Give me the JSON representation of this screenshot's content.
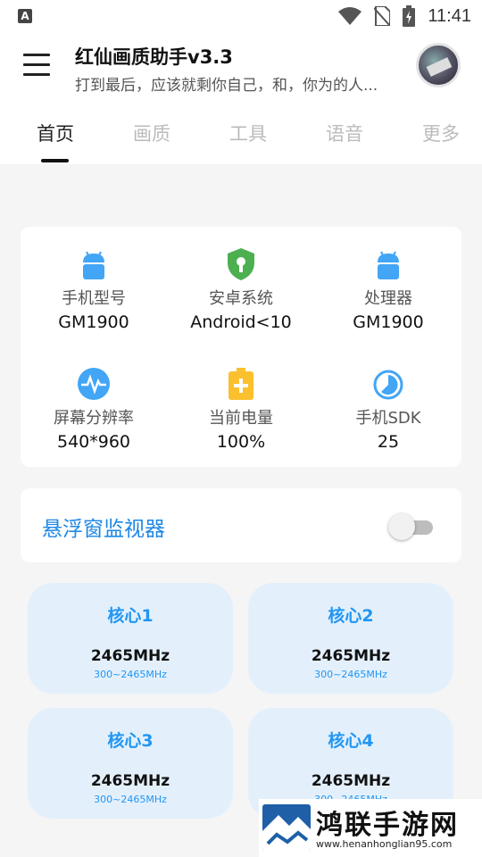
{
  "status_bar": {
    "app_indicator": "A",
    "time": "11:41"
  },
  "header": {
    "title": "红仙画质助手v3.3",
    "subtitle": "打到最后，应该就剩你自己，和，你为的人..."
  },
  "tabs": [
    {
      "label": "首页",
      "active": true
    },
    {
      "label": "画质",
      "active": false
    },
    {
      "label": "工具",
      "active": false
    },
    {
      "label": "语音",
      "active": false
    },
    {
      "label": "更多",
      "active": false
    }
  ],
  "device_info": [
    {
      "label": "手机型号",
      "value": "GM1900",
      "icon": "android-icon"
    },
    {
      "label": "安卓系统",
      "value": "Android<10",
      "icon": "shield-key-icon"
    },
    {
      "label": "处理器",
      "value": "GM1900",
      "icon": "android-icon"
    },
    {
      "label": "屏幕分辨率",
      "value": "540*960",
      "icon": "pulse-icon"
    },
    {
      "label": "当前电量",
      "value": "100%",
      "icon": "battery-icon"
    },
    {
      "label": "手机SDK",
      "value": "25",
      "icon": "pie-clock-icon"
    }
  ],
  "floating_monitor": {
    "label": "悬浮窗监视器",
    "enabled": false
  },
  "cores": [
    {
      "name": "核心1",
      "freq": "2465MHz",
      "range": "300~2465MHz"
    },
    {
      "name": "核心2",
      "freq": "2465MHz",
      "range": "300~2465MHz"
    },
    {
      "name": "核心3",
      "freq": "2465MHz",
      "range": "300~2465MHz"
    },
    {
      "name": "核心4",
      "freq": "2465MHz",
      "range": "300~2465MHz"
    }
  ],
  "watermark": {
    "title": "鸿联手游网",
    "url": "www.henanhonglian95.com"
  },
  "colors": {
    "accent": "#1e88e5",
    "core_bg": "#e3f0fc",
    "android": "#42a5f5",
    "shield": "#4caf50",
    "battery": "#fbc02d"
  }
}
